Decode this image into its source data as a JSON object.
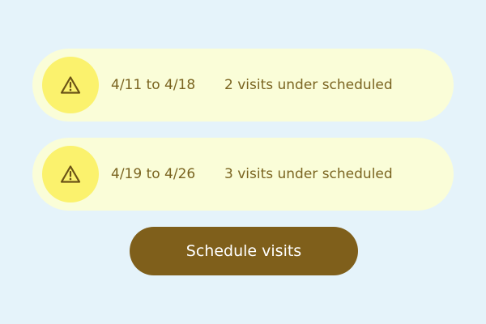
{
  "alerts": [
    {
      "range": "4/11 to 4/18",
      "status": "2 visits under scheduled",
      "icon": "warning-icon"
    },
    {
      "range": "4/19 to 4/26",
      "status": "3 visits under scheduled",
      "icon": "warning-icon"
    }
  ],
  "action": {
    "label": "Schedule visits"
  },
  "colors": {
    "background": "#e5f3fa",
    "alert_bg": "#fafdd8",
    "icon_bg": "#fbf26d",
    "text": "#7a6420",
    "button_bg": "#7f5f1b",
    "button_text": "#ffffff"
  }
}
